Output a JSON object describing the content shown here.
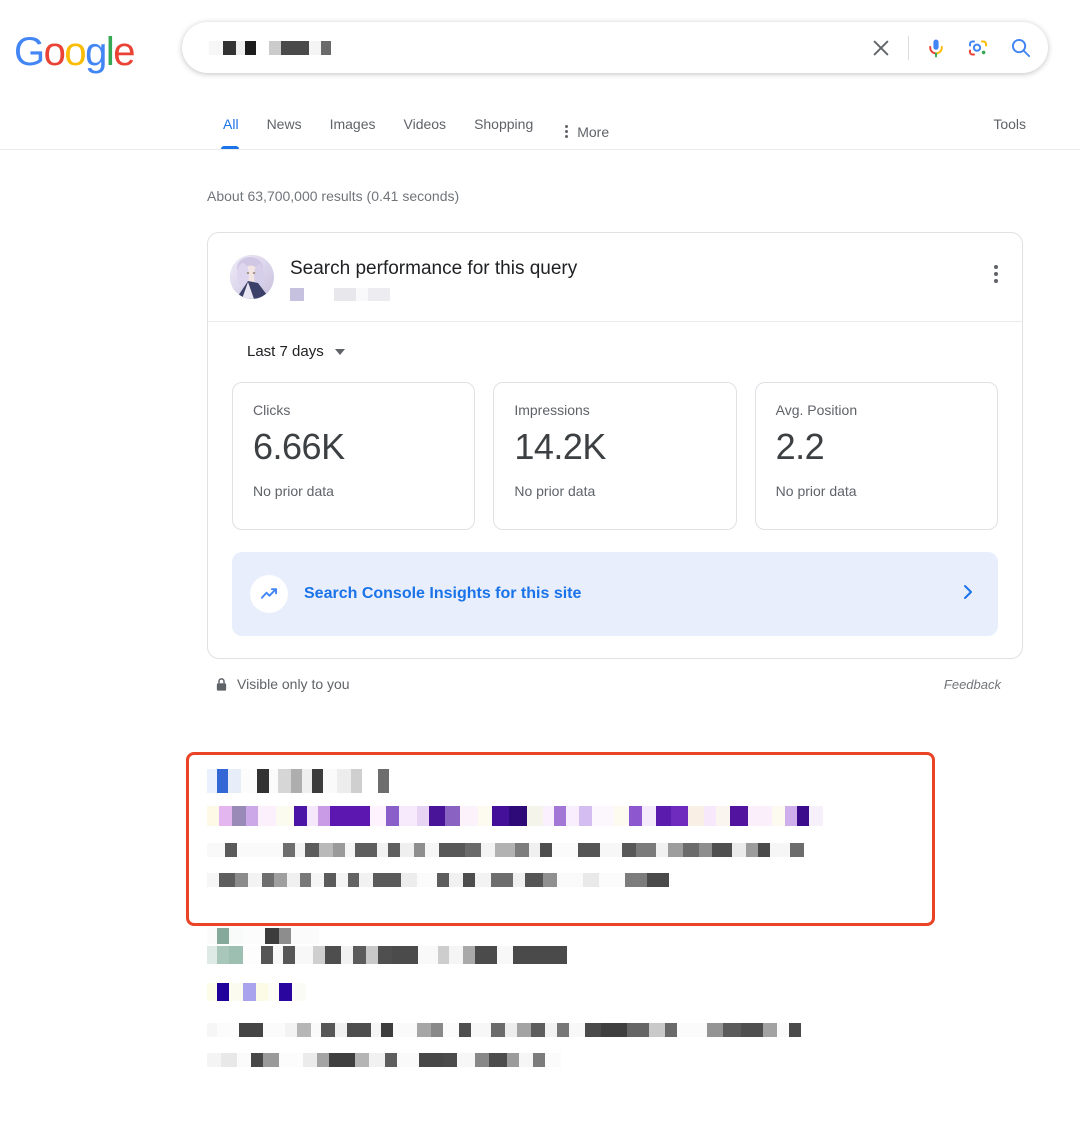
{
  "browser": {
    "page_type": "google-search-results"
  },
  "header": {
    "logo": {
      "letters": [
        {
          "char": "G",
          "color": "#4285F4"
        },
        {
          "char": "o",
          "color": "#EA4335"
        },
        {
          "char": "o",
          "color": "#FBBC05"
        },
        {
          "char": "g",
          "color": "#4285F4"
        },
        {
          "char": "l",
          "color": "#34A853"
        },
        {
          "char": "e",
          "color": "#EA4335"
        }
      ],
      "alt": "Google"
    },
    "search": {
      "value": "",
      "placeholder": "",
      "redacted": true,
      "clear_label": "Clear",
      "voice_label": "Search by voice",
      "lens_label": "Search by image",
      "submit_label": "Google Search"
    }
  },
  "nav": {
    "tabs": [
      {
        "label": "All",
        "active": true
      },
      {
        "label": "News",
        "active": false
      },
      {
        "label": "Images",
        "active": false
      },
      {
        "label": "Videos",
        "active": false
      },
      {
        "label": "Shopping",
        "active": false
      }
    ],
    "more_label": "More",
    "tools_label": "Tools"
  },
  "main": {
    "results_count": "About 63,700,000 results (0.41 seconds)"
  },
  "performance_card": {
    "title": "Search performance for this query",
    "subtitle_redacted": true,
    "menu_label": "More options",
    "date_range": "Last 7 days",
    "metrics": [
      {
        "label": "Clicks",
        "value": "6.66K",
        "note": "No prior data"
      },
      {
        "label": "Impressions",
        "value": "14.2K",
        "note": "No prior data"
      },
      {
        "label": "Avg. Position",
        "value": "2.2",
        "note": "No prior data"
      }
    ],
    "insights": {
      "label": "Search Console Insights for this site",
      "icon": "trending-up-icon",
      "accent": "#1a73e8",
      "background": "#e8eefc"
    },
    "footer": {
      "visibility": "Visible only to you",
      "feedback": "Feedback"
    }
  },
  "search_results": {
    "highlight_color": "#EA4326",
    "items": [
      {
        "redacted": true,
        "highlighted": true
      },
      {
        "redacted": true,
        "highlighted": false
      }
    ]
  }
}
